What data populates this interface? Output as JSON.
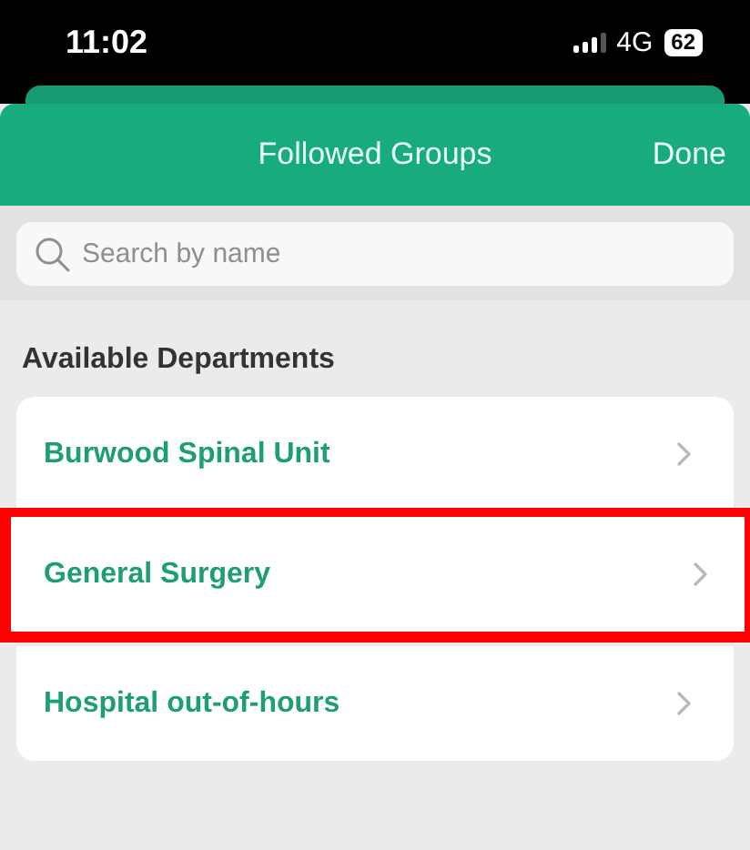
{
  "status_bar": {
    "time": "11:02",
    "network": "4G",
    "battery": "62"
  },
  "header": {
    "title": "Followed Groups",
    "done": "Done"
  },
  "search": {
    "placeholder": "Search by name"
  },
  "section": {
    "title": "Available Departments"
  },
  "departments": [
    {
      "name": "Burwood Spinal Unit",
      "highlighted": false
    },
    {
      "name": "General Surgery",
      "highlighted": true
    },
    {
      "name": "Hospital out-of-hours",
      "highlighted": false
    }
  ]
}
